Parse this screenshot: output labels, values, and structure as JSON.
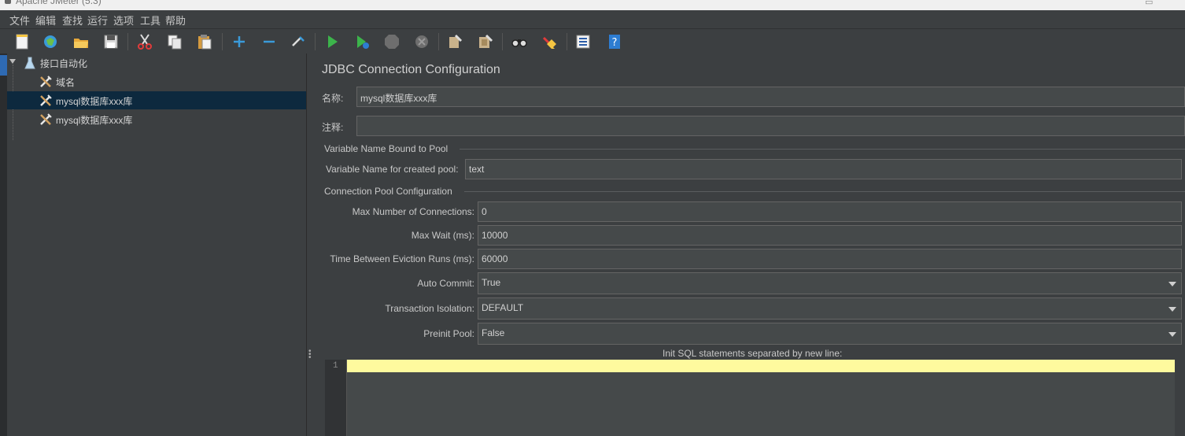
{
  "window": {
    "title": "Apache JMeter (5.3)"
  },
  "menu": [
    "文件",
    "编辑",
    "查找",
    "运行",
    "选项",
    "工具",
    "帮助"
  ],
  "toolbar": {
    "icons": [
      "new-icon",
      "templates-icon",
      "open-icon",
      "save-icon",
      "cut-icon",
      "copy-icon",
      "paste-icon",
      "expand-icon",
      "collapse-icon",
      "toggle-icon",
      "start-icon",
      "start-no-pause-icon",
      "stop-icon",
      "shutdown-icon",
      "clear-icon",
      "clear-all-icon",
      "search-icon",
      "reset-search-icon",
      "function-helper-icon",
      "help-icon"
    ]
  },
  "tree": {
    "root": "接口自动化",
    "items": [
      {
        "label": "域名",
        "selected": false
      },
      {
        "label": "mysql数据库xxx库",
        "selected": true
      },
      {
        "label": "mysql数据库xxx库",
        "selected": false
      }
    ]
  },
  "panel": {
    "title": "JDBC Connection Configuration",
    "name_label": "名称:",
    "name_value": "mysql数据库xxx库",
    "comment_label": "注释:",
    "comment_value": "",
    "section_pool_var": "Variable Name Bound to Pool",
    "pool_var_label": "Variable Name for created pool:",
    "pool_var_value": "text",
    "section_pool_config": "Connection Pool Configuration",
    "max_conn_label": "Max Number of Connections:",
    "max_conn_value": "0",
    "max_wait_label": "Max Wait (ms):",
    "max_wait_value": "10000",
    "eviction_label": "Time Between Eviction Runs (ms):",
    "eviction_value": "60000",
    "auto_commit_label": "Auto Commit:",
    "auto_commit_value": "True",
    "isolation_label": "Transaction Isolation:",
    "isolation_value": "DEFAULT",
    "preinit_label": "Preinit Pool:",
    "preinit_value": "False",
    "init_sql_label": "Init SQL statements separated by new line:",
    "init_sql_line": "1"
  },
  "colors": {
    "background": "#3c3f41",
    "selection": "#0d293e",
    "editor_highlight": "#fefa9e",
    "accent": "#2e6ab3"
  }
}
